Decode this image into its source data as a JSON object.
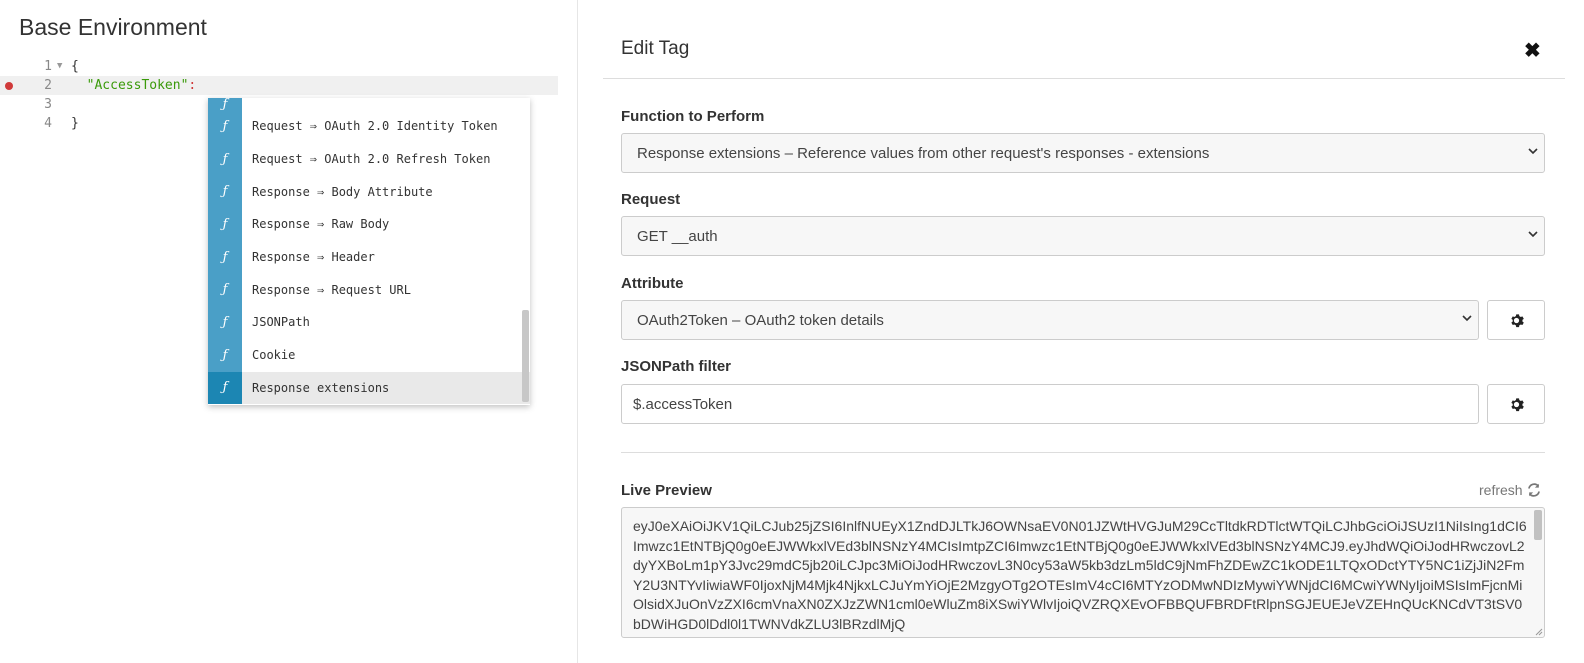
{
  "environment": {
    "title": "Base Environment",
    "editor": {
      "lines": [
        {
          "num": "1",
          "text": "{"
        },
        {
          "num": "2",
          "key": "\"AccessToken\"",
          "colon": ":"
        },
        {
          "num": "3",
          "text": ""
        },
        {
          "num": "4",
          "text": "}"
        }
      ]
    }
  },
  "autocomplete": {
    "icon_glyph": "ƒ",
    "items": [
      "Request ⇒ OAuth 2.0 Identity Token",
      "Request ⇒ OAuth 2.0 Refresh Token",
      "Response ⇒ Body Attribute",
      "Response ⇒ Raw Body",
      "Response ⇒ Header",
      "Response ⇒ Request URL",
      "JSONPath",
      "Cookie",
      "Response extensions"
    ],
    "selected_index": 8
  },
  "modal": {
    "title": "Edit Tag",
    "close_glyph": "✖",
    "function_label": "Function to Perform",
    "function_value": "Response extensions – Reference values from other request's responses - extensions",
    "request_label": "Request",
    "request_value": "GET __auth",
    "attribute_label": "Attribute",
    "attribute_value": "OAuth2Token – OAuth2 token details",
    "jsonpath_label": "JSONPath filter",
    "jsonpath_value": "$.accessToken",
    "preview_label": "Live Preview",
    "refresh_label": "refresh",
    "preview_text": "eyJ0eXAiOiJKV1QiLCJub25jZSI6InlfNUEyX1ZndDJLTkJ6OWNsaEV0N01JZWtHVGJuM29CcTltdkRDTlctWTQiLCJhbGciOiJSUzI1NiIsIng1dCI6Imwzc1EtNTBjQ0g0eEJWWkxlVEd3blNSNzY4MCIsImtpZCI6Imwzc1EtNTBjQ0g0eEJWWkxlVEd3blNSNzY4MCJ9.eyJhdWQiOiJodHRwczovL2dyYXBoLm1pY3Jvc29mdC5jb20iLCJpc3MiOiJodHRwczovL3N0cy53aW5kb3dzLm5ldC9jNmFhZDEwZC1kODE1LTQxODctYTY5NC1iZjJiN2FmY2U3NTYvIiwiaWF0IjoxNjM4Mjk4NjkxLCJuYmYiOjE2MzgyOTg2OTEsImV4cCI6MTYzODMwNDIzMywiYWNjdCI6MCwiYWNyIjoiMSIsImFjcnMiOlsidXJuOnVzZXI6cmVnaXN0ZXJzZWN1cml0eWluZm8iXSwiYWlvIjoiQVZRQXEvOFBBQUFBRDFtRlpnSGJEUEJeVZEHnQUcKNCdVT3tSV0bDWiHGD0lDdl0l1TWNVdkZLU3lBRzdlMjQ"
  }
}
